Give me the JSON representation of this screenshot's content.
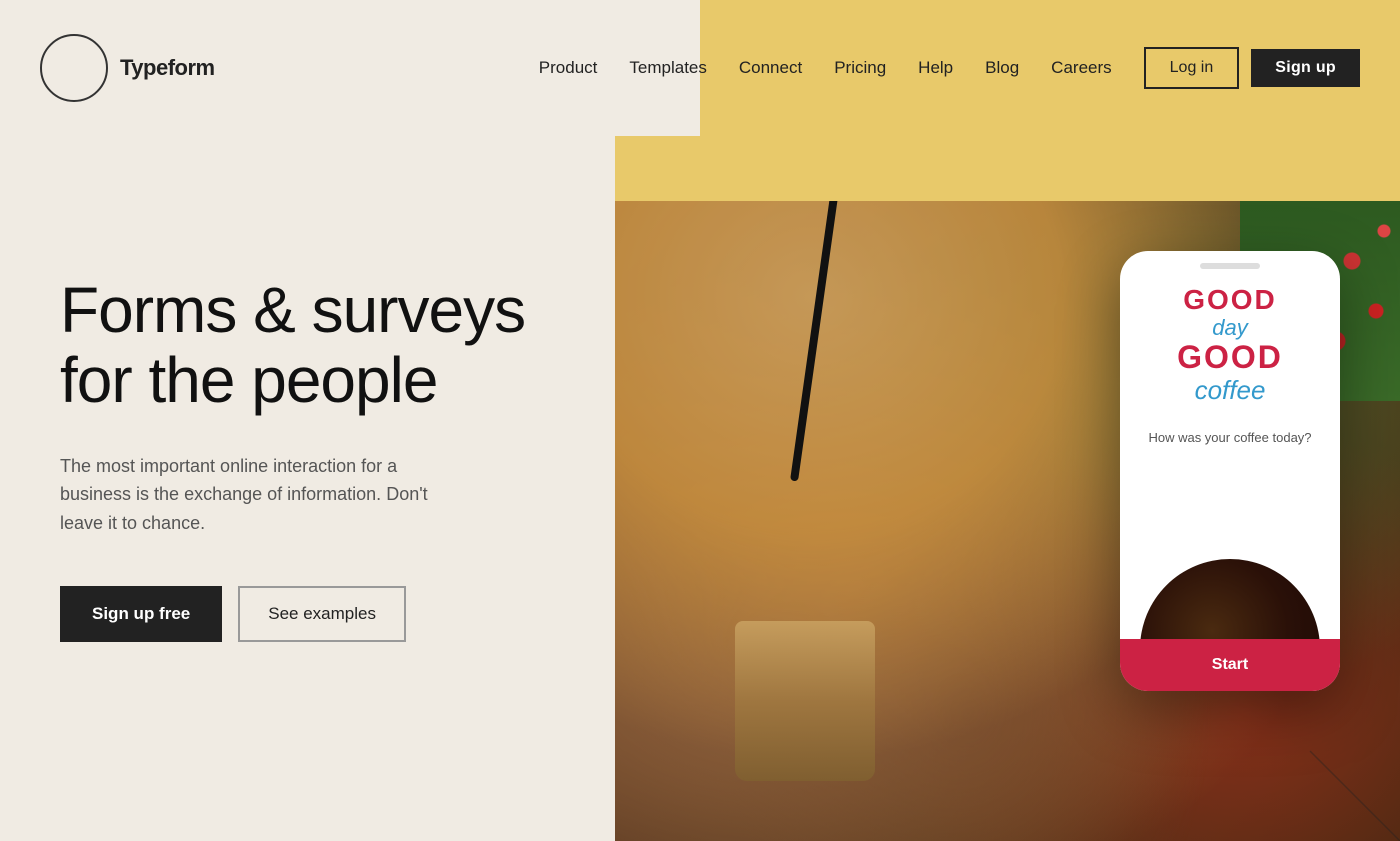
{
  "logo": {
    "circle_label": "",
    "text": "Typeform"
  },
  "nav": {
    "links": [
      {
        "id": "product",
        "label": "Product"
      },
      {
        "id": "templates",
        "label": "Templates"
      },
      {
        "id": "connect",
        "label": "Connect"
      },
      {
        "id": "pricing",
        "label": "Pricing"
      },
      {
        "id": "help",
        "label": "Help"
      },
      {
        "id": "blog",
        "label": "Blog"
      },
      {
        "id": "careers",
        "label": "Careers"
      }
    ],
    "login_label": "Log in",
    "signup_label": "Sign up"
  },
  "hero": {
    "heading_line1": "Forms & surveys",
    "heading_line2": "for the people",
    "subtext": "The most important online interaction for a business is the exchange of information. Don't leave it to chance.",
    "cta_primary": "Sign up free",
    "cta_secondary": "See examples"
  },
  "phone": {
    "brand_good1": "GOOD",
    "brand_day": "day",
    "brand_good2": "GOOD",
    "brand_coffee": "coffee",
    "question": "How was your coffee today?",
    "start_label": "Start"
  }
}
